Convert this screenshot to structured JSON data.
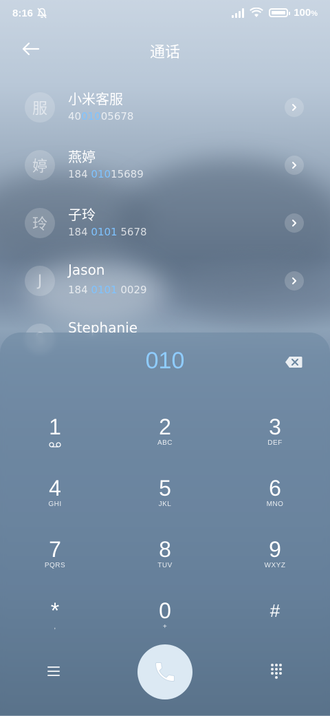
{
  "status": {
    "time": "8:16",
    "battery": "100"
  },
  "header": {
    "title": "通话"
  },
  "contacts": [
    {
      "avatar": "服",
      "name": "小米客服",
      "num_pre": "40",
      "num_hl": "010",
      "num_post": "05678"
    },
    {
      "avatar": "婷",
      "name": "燕婷",
      "num_pre": "184 ",
      "num_hl": "010",
      "num_post": "15689"
    },
    {
      "avatar": "玲",
      "name": "子玲",
      "num_pre": "184 ",
      "num_hl": "0101",
      "num_post": " 5678"
    },
    {
      "avatar": "J",
      "name": "Jason",
      "num_pre": "184 ",
      "num_hl": "0101",
      "num_post": " 0029"
    },
    {
      "avatar": "S",
      "name": "Stephanie",
      "num_pre": "",
      "num_hl": "",
      "num_post": ""
    }
  ],
  "dialpad": {
    "entered": "010",
    "keys": [
      {
        "num": "1",
        "sub": ""
      },
      {
        "num": "2",
        "sub": "ABC"
      },
      {
        "num": "3",
        "sub": "DEF"
      },
      {
        "num": "4",
        "sub": "GHI"
      },
      {
        "num": "5",
        "sub": "JKL"
      },
      {
        "num": "6",
        "sub": "MNO"
      },
      {
        "num": "7",
        "sub": "PQRS"
      },
      {
        "num": "8",
        "sub": "TUV"
      },
      {
        "num": "9",
        "sub": "WXYZ"
      },
      {
        "num": "*",
        "sub": ","
      },
      {
        "num": "0",
        "sub": "+"
      },
      {
        "num": "#",
        "sub": ""
      }
    ]
  },
  "icons": {
    "back": "back-arrow-icon",
    "delete": "backspace-icon",
    "call": "phone-icon",
    "menu": "menu-icon",
    "keypad": "keypad-icon",
    "voicemail": "voicemail-icon"
  },
  "colors": {
    "accent": "#7fc3ff",
    "call_button": "#dce9f3"
  }
}
